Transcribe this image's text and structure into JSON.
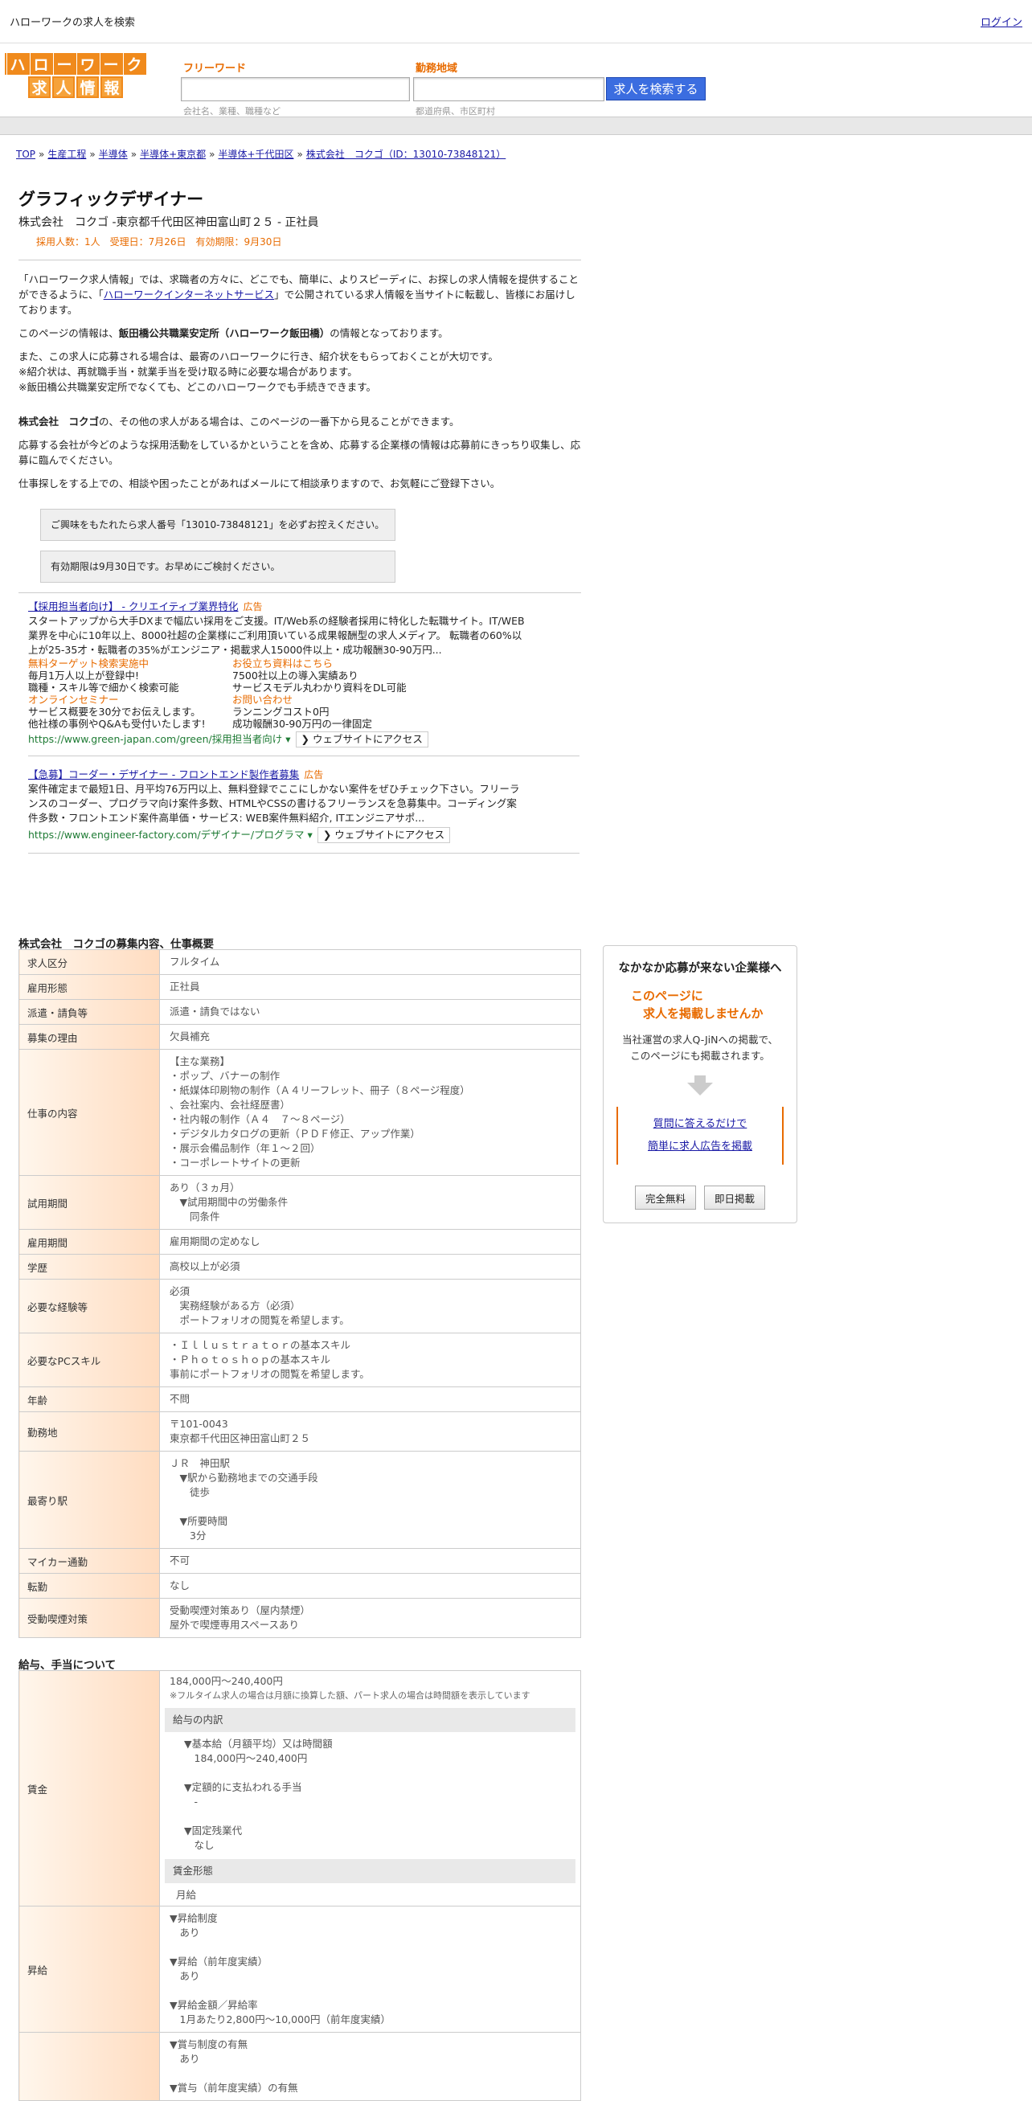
{
  "topbar": {
    "title": "ハローワークの求人を検索",
    "link": "ログイン"
  },
  "logo": {
    "row1": [
      "ハ",
      "ロ",
      "ー",
      "ワ",
      "ー",
      "ク"
    ],
    "row2": [
      "求",
      "人",
      "情",
      "報"
    ]
  },
  "search": {
    "keyword_label": "フリーワード",
    "keyword_placeholder": "",
    "keyword_hint": "会社名、業種、職種など",
    "area_label": "勤務地域",
    "area_placeholder": "",
    "area_hint": "都道府県、市区町村",
    "button": "求人を検索する"
  },
  "breadcrumb": [
    {
      "label": "TOP"
    },
    {
      "label": "生産工程"
    },
    {
      "label": "半導体"
    },
    {
      "label": "半導体+東京都"
    },
    {
      "label": "半導体+千代田区"
    },
    {
      "label": "株式会社　コクゴ（ID：13010-73848121）"
    }
  ],
  "job": {
    "title": "グラフィックデザイナー",
    "subtitle": "株式会社　コクゴ -東京都千代田区神田富山町２５ - 正社員",
    "meta": "採用人数：1人　受理日：7月26日　有効期限：9月30日"
  },
  "intro": {
    "p1a": "「ハローワーク求人情報」では、求職者の方々に、どこでも、簡単に、よりスピーディに、お探しの求人情報を提供することができるように、「",
    "p1link": "ハローワークインターネットサービス",
    "p1b": "」で公開されている求人情報を当サイトに転載し、皆様にお届けしております。",
    "p2a": "このページの情報は、",
    "p2b": "飯田橋公共職業安定所（ハローワーク飯田橋）",
    "p2c": "の情報となっております。",
    "p3": "また、この求人に応募される場合は、最寄のハローワークに行き、紹介状をもらっておくことが大切です。\n※紹介状は、再就職手当・就業手当を受け取る時に必要な場合があります。\n※飯田橋公共職業安定所でなくても、どこのハローワークでも手続きできます。",
    "p4a": "株式会社　コクゴ",
    "p4b": "の、その他の求人がある場合は、このページの一番下から見ることができます。",
    "p5": "応募する会社が今どのような採用活動をしているかということを含め、応募する企業様の情報は応募前にきっちり収集し、応募に臨んでください。",
    "p6": "仕事探しをする上での、相談や困ったことがあればメールにて相談承りますので、お気軽にご登録下さい。",
    "box1": "ご興味をもたれたら求人番号「13010-73848121」を必ずお控えください。",
    "box2": "有効期限は9月30日です。お早めにご検討ください。"
  },
  "ads": [
    {
      "title": "【採用担当者向け】 - クリエイティブ業界特化",
      "tag": "広告",
      "desc": "スタートアップから大手DXまで幅広い採用をご支援。IT/Web系の経験者採用に特化した転職サイト。IT/WEB業界を中心に10年以上、8000社超の企業様にご利用頂いている成果報酬型の求人メディア。 転職者の60%以上が25-35才・転職者の35%がエンジニア・掲載求人15000件以上・成功報酬30-90万円...",
      "grid": [
        {
          "o": "無料ターゲット検索実施中",
          "t": "毎月1万人以上が登録中!\n職種・スキル等で細かく検索可能"
        },
        {
          "o": "お役立ち資料はこちら",
          "t": "7500社以上の導入実績あり\nサービスモデル丸わかり資料をDL可能"
        },
        {
          "o": "オンラインセミナー",
          "t": "サービス概要を30分でお伝えします。\n他社様の事例やQ&Aも受付いたします!"
        },
        {
          "o": "お問い合わせ",
          "t": "ランニングコスト0円\n成功報酬30-90万円の一律固定"
        }
      ],
      "url": "https://www.green-japan.com/green/採用担当者向け ▾",
      "button": "❯ ウェブサイトにアクセス"
    },
    {
      "title": "【急募】コーダー・デザイナー - フロントエンド製作者募集",
      "tag": "広告",
      "desc": "案件確定まで最短1日、月平均76万円以上、無料登録でここにしかない案件をぜひチェック下さい。フリーランスのコーダー、プログラマ向け案件多数、HTMLやCSSの書けるフリーランスを急募集中。コーディング案件多数・フロントエンド案件高単価・サービス: WEB案件無料紹介, ITエンジニアサポ...",
      "url": "https://www.engineer-factory.com/デザイナー/プログラマ ▾",
      "button": "❯ ウェブサイトにアクセス"
    }
  ],
  "recruit": {
    "title": "株式会社　コクゴの募集内容、仕事概要",
    "rows": [
      {
        "h": "求人区分",
        "v": "フルタイム"
      },
      {
        "h": "雇用形態",
        "v": "正社員"
      },
      {
        "h": "派遣・請負等",
        "v": "派遣・請負ではない"
      },
      {
        "h": "募集の理由",
        "v": "欠員補充"
      },
      {
        "h": "仕事の内容",
        "v": "【主な業務】\n・ポップ、バナーの制作\n・紙媒体印刷物の制作（Ａ４リーフレット、冊子（８ページ程度）\n、会社案内、会社経歴書）\n・社内報の制作（Ａ４　７～８ページ）\n・デジタルカタログの更新（ＰＤＦ修正、アップ作業）\n・展示会備品制作（年１～２回）\n・コーポレートサイトの更新"
      },
      {
        "h": "試用期間",
        "v": "あり（３ヵ月）\n　▼試用期間中の労働条件\n　　同条件"
      },
      {
        "h": "雇用期間",
        "v": "雇用期間の定めなし"
      },
      {
        "h": "学歴",
        "v": "高校以上が必須"
      },
      {
        "h": "必要な経験等",
        "v": "必須\n　実務経験がある方（必須）\n　ポートフォリオの閲覧を希望します。"
      },
      {
        "h": "必要なPCスキル",
        "v": "・Ｉｌｌｕｓｔｒａｔｏｒの基本スキル\n・Ｐｈｏｔｏｓｈｏｐの基本スキル\n事前にポートフォリオの閲覧を希望します。"
      },
      {
        "h": "年齢",
        "v": "不問"
      },
      {
        "h": "勤務地",
        "v": "〒101-0043\n東京都千代田区神田富山町２５"
      },
      {
        "h": "最寄り駅",
        "v": "ＪＲ　神田駅\n　▼駅から勤務地までの交通手段\n　　徒歩\n\n　▼所要時間\n　　3分"
      },
      {
        "h": "マイカー通勤",
        "v": "不可"
      },
      {
        "h": "転勤",
        "v": "なし"
      },
      {
        "h": "受動喫煙対策",
        "v": "受動喫煙対策あり（屋内禁煙）\n屋外で喫煙専用スペースあり"
      }
    ]
  },
  "salary": {
    "title": "給与、手当について",
    "wage_head": "賃金",
    "wage_range": "184,000円〜240,400円",
    "wage_note": "※フルタイム求人の場合は月額に換算した額、パート求人の場合は時間額を表示しています",
    "breakdown_head": "給与の内訳",
    "breakdown": "▼基本給（月額平均）又は時間額\n　184,000円〜240,400円\n\n▼定額的に支払われる手当\n　-\n\n▼固定残業代\n　なし",
    "form_head": "賃金形態",
    "form": "月給",
    "raise_head": "昇給",
    "raise": "▼昇給制度\n　あり\n\n▼昇給（前年度実績）\n　あり\n\n▼昇給金額／昇給率\n　1月あたり2,800円〜10,000円（前年度実績）",
    "bonus": "▼賞与制度の有無\n　あり\n\n▼賞与（前年度実績）の有無"
  },
  "sidebox": {
    "t1": "なかなか応募が来ない企業様へ",
    "t2a": "このページに",
    "t2b": "　求人を掲載しませんか",
    "t3": "当社運営の求人Q-JiNへの掲載で、\nこのページにも掲載されます。",
    "link1": "質問に答えるだけで",
    "link2": "簡単に求人広告を掲載",
    "btn1": "完全無料",
    "btn2": "即日掲載"
  }
}
